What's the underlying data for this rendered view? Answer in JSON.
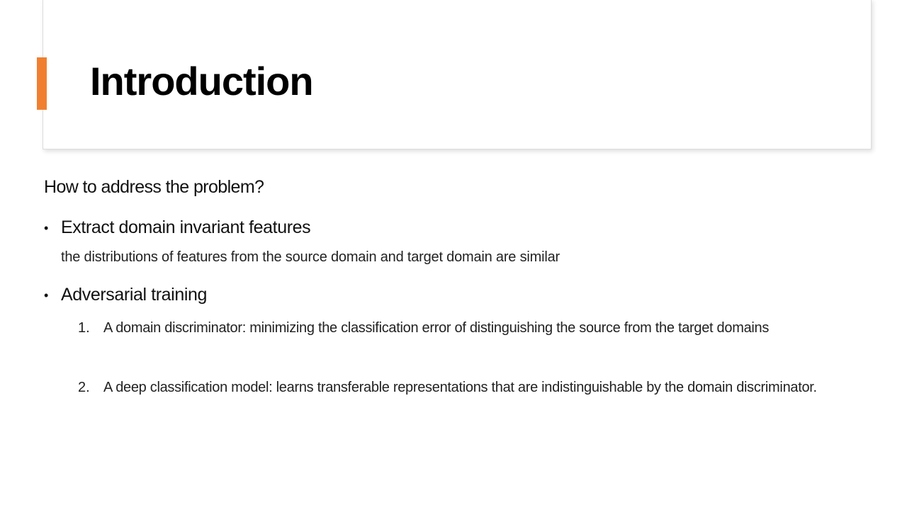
{
  "slide": {
    "title": "Introduction",
    "accent_color": "#f08030",
    "question": "How to address the problem?",
    "bullets": [
      {
        "marker": "•",
        "heading": "Extract domain invariant features",
        "detail": "the distributions of features from the source domain and target domain are similar"
      },
      {
        "marker": "•",
        "heading": "Adversarial training",
        "items": [
          {
            "number": "1.",
            "text": "A domain discriminator: minimizing the classification error of distinguishing the source from the target domains"
          },
          {
            "number": "2.",
            "text": "A deep classification model: learns transferable representations that are indistinguishable by the domain discriminator."
          }
        ]
      }
    ]
  }
}
